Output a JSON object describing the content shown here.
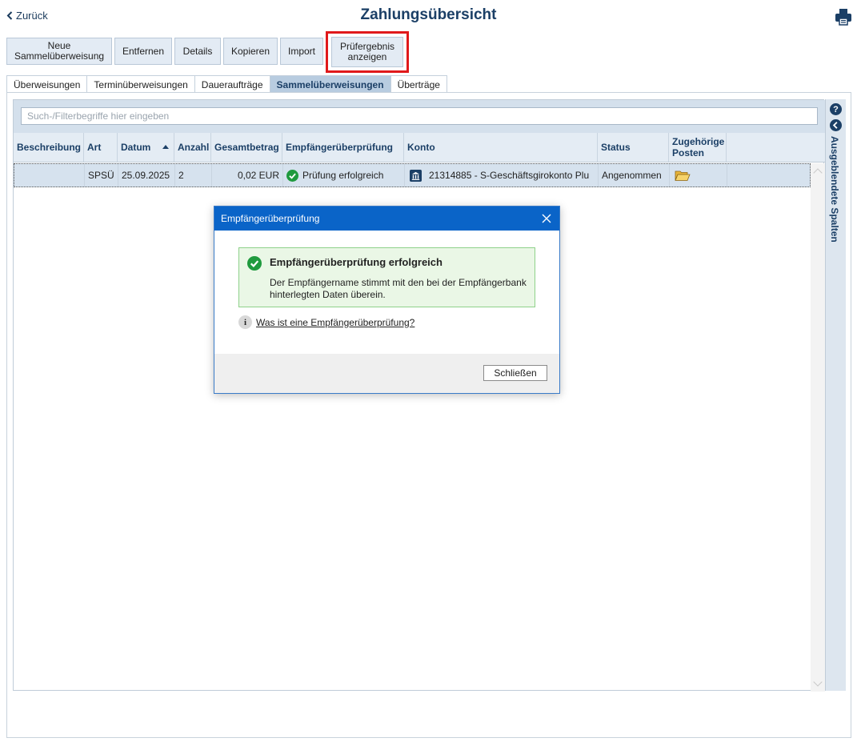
{
  "header": {
    "back_label": "Zurück",
    "title": "Zahlungsübersicht",
    "print_icon": "printer-icon"
  },
  "toolbar": {
    "buttons": [
      "Neue Sammelüberweisung",
      "Entfernen",
      "Details",
      "Kopieren",
      "Import",
      "Prüfergebnis anzeigen"
    ],
    "highlight_color": "#e0191b"
  },
  "tabs": {
    "items": [
      "Überweisungen",
      "Terminüberweisungen",
      "Daueraufträge",
      "Sammelüberweisungen",
      "Überträge"
    ],
    "active": "Sammelüberweisungen"
  },
  "filter": {
    "placeholder": "Such-/Filterbegriffe hier eingeben"
  },
  "table": {
    "columns": [
      "Beschreibung",
      "Art",
      "Datum",
      "Anzahl",
      "Gesamtbetrag",
      "Empfängerüberprüfung",
      "Konto",
      "Status",
      "Zugehörige Posten"
    ],
    "sorted_by": "Datum",
    "rows": [
      {
        "beschreibung": "",
        "art": "SPSÜ",
        "datum": "25.09.2025",
        "anzahl": "2",
        "gesamtbetrag": "0,02 EUR",
        "empfaengerpruefung": "Prüfung erfolgreich",
        "konto": "21314885 - S-Geschäftsgirokonto Plu",
        "status": "Angenommen"
      }
    ]
  },
  "side_panel": {
    "label": "Ausgeblendete Spalten",
    "help_glyph": "?"
  },
  "dialog": {
    "title": "Empfängerüberprüfung",
    "success_title": "Empfängerüberprüfung erfolgreich",
    "success_text": "Der Empfängername stimmt mit den bei der Empfängerbank hinterlegten Daten überein.",
    "info_glyph": "i",
    "info_link": "Was ist eine Empfängerüberprüfung?",
    "close_label": "Schließen"
  },
  "colors": {
    "accent": "#1b3f66",
    "dialog_title_bg": "#0a64c8",
    "success_bg": "#eaf7e6",
    "success_icon": "#1f9a3e"
  }
}
